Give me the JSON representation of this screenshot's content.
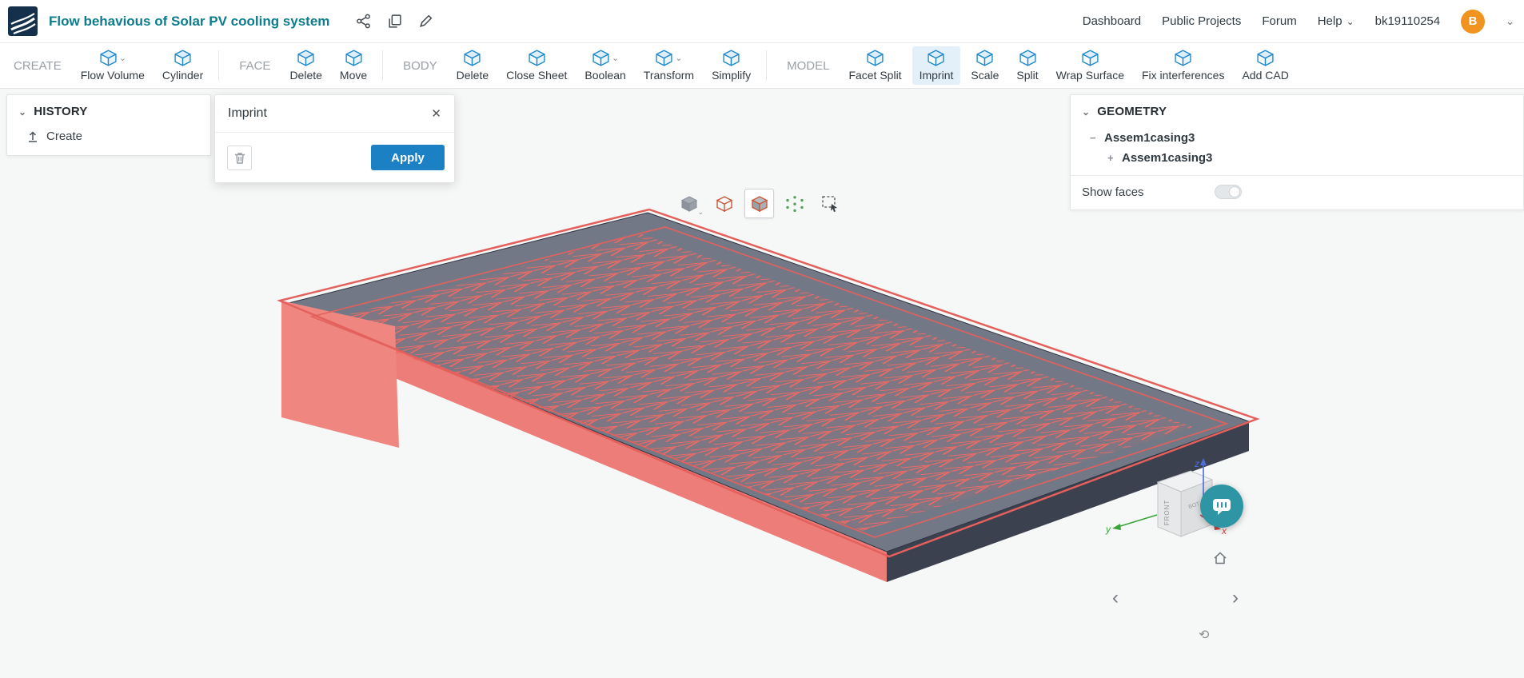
{
  "header": {
    "title": "Flow behavious of Solar PV cooling system",
    "nav": [
      {
        "label": "Dashboard"
      },
      {
        "label": "Public Projects"
      },
      {
        "label": "Forum"
      },
      {
        "label": "Help",
        "dropdown": true
      }
    ],
    "username": "bk19110254",
    "avatar_initial": "B"
  },
  "toolbar": {
    "groups": [
      {
        "label": "CREATE",
        "items": [
          {
            "label": "Flow Volume",
            "dropdown": true
          },
          {
            "label": "Cylinder"
          }
        ]
      },
      {
        "label": "FACE",
        "items": [
          {
            "label": "Delete"
          },
          {
            "label": "Move"
          }
        ]
      },
      {
        "label": "BODY",
        "items": [
          {
            "label": "Delete"
          },
          {
            "label": "Close Sheet"
          },
          {
            "label": "Boolean",
            "dropdown": true
          },
          {
            "label": "Transform",
            "dropdown": true
          },
          {
            "label": "Simplify"
          }
        ]
      },
      {
        "label": "MODEL",
        "items": [
          {
            "label": "Facet Split"
          },
          {
            "label": "Imprint",
            "selected": true
          },
          {
            "label": "Scale"
          },
          {
            "label": "Split"
          },
          {
            "label": "Wrap Surface"
          },
          {
            "label": "Fix interferences"
          },
          {
            "label": "Add CAD"
          }
        ]
      }
    ]
  },
  "panels": {
    "history": {
      "title": "HISTORY",
      "items": [
        {
          "label": "Create"
        }
      ]
    },
    "geometry": {
      "title": "GEOMETRY",
      "tree": [
        {
          "label": "Assem1casing3",
          "glyph": "−"
        },
        {
          "label": "Assem1casing3",
          "glyph": "+",
          "child": true
        }
      ],
      "show_faces": {
        "label": "Show faces",
        "enabled": false
      }
    }
  },
  "dialog": {
    "title": "Imprint",
    "apply_label": "Apply"
  },
  "viewport": {
    "view_toolbar": [
      {
        "name": "shaded-view",
        "dropdown": true
      },
      {
        "name": "wireframe-view"
      },
      {
        "name": "shaded-wireframe-view",
        "selected": true
      },
      {
        "name": "vertices-view"
      },
      {
        "name": "box-select"
      }
    ],
    "orientation_cube": {
      "front_label": "FRONT",
      "bot_label": "BOT"
    },
    "axes": {
      "x": "x",
      "y": "y",
      "z": "z"
    }
  },
  "glyphs": {
    "chevron_down": "⌄",
    "chevron_left": "‹",
    "chevron_right": "›",
    "close": "✕",
    "rotate": "⟲"
  },
  "colors": {
    "title_teal": "#0c7d8e",
    "accent_blue": "#1c80c4",
    "toolbar_icon_blue": "#1e88c9",
    "selected_item_bg": "#e4f0f9",
    "selection_red": "#e4605c",
    "model_face_red": "#ed7d78",
    "casing_gray": "#565c6e",
    "avatar_orange": "#f0931f",
    "chat_teal": "#2e95a4"
  }
}
